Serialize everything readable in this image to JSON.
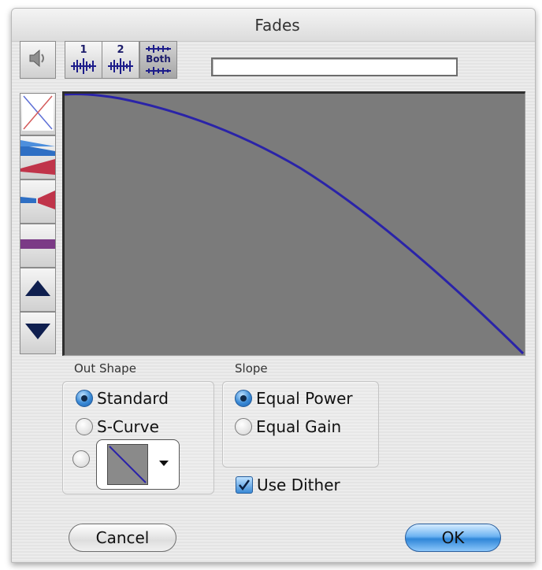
{
  "window": {
    "title": "Fades"
  },
  "toolbar": {
    "buttons": [
      {
        "icon": "speaker-icon",
        "label": ""
      },
      {
        "icon": "channel-waveform-icon",
        "label": "1"
      },
      {
        "icon": "channel-waveform-icon",
        "label": "2"
      },
      {
        "icon": "both-channels-icon",
        "label": "Both"
      }
    ],
    "progress": 0
  },
  "side_tools": [
    {
      "icon": "crossfade-x-icon"
    },
    {
      "icon": "fade-in-out-icon"
    },
    {
      "icon": "fade-in-icon"
    },
    {
      "icon": "flat-level-icon"
    },
    {
      "icon": "arrow-up-icon"
    },
    {
      "icon": "arrow-down-icon"
    }
  ],
  "curve": {
    "shape": "equal-power fade out",
    "color": "#2a23a8",
    "background": "#7b7b7b"
  },
  "out_shape": {
    "label": "Out Shape",
    "options": [
      "Standard",
      "S-Curve"
    ],
    "selected": "Standard"
  },
  "slope": {
    "label": "Slope",
    "options": [
      "Equal Power",
      "Equal Gain"
    ],
    "selected": "Equal Power"
  },
  "dither": {
    "label": "Use Dither",
    "checked": true
  },
  "buttons": {
    "cancel": "Cancel",
    "ok": "OK"
  },
  "colors": {
    "accent": "#3a8ad6",
    "fade_blue": "#2e6fc4",
    "fade_red": "#c0344a",
    "fade_purple": "#7b3a86",
    "arrow_navy": "#0f1f4f"
  }
}
